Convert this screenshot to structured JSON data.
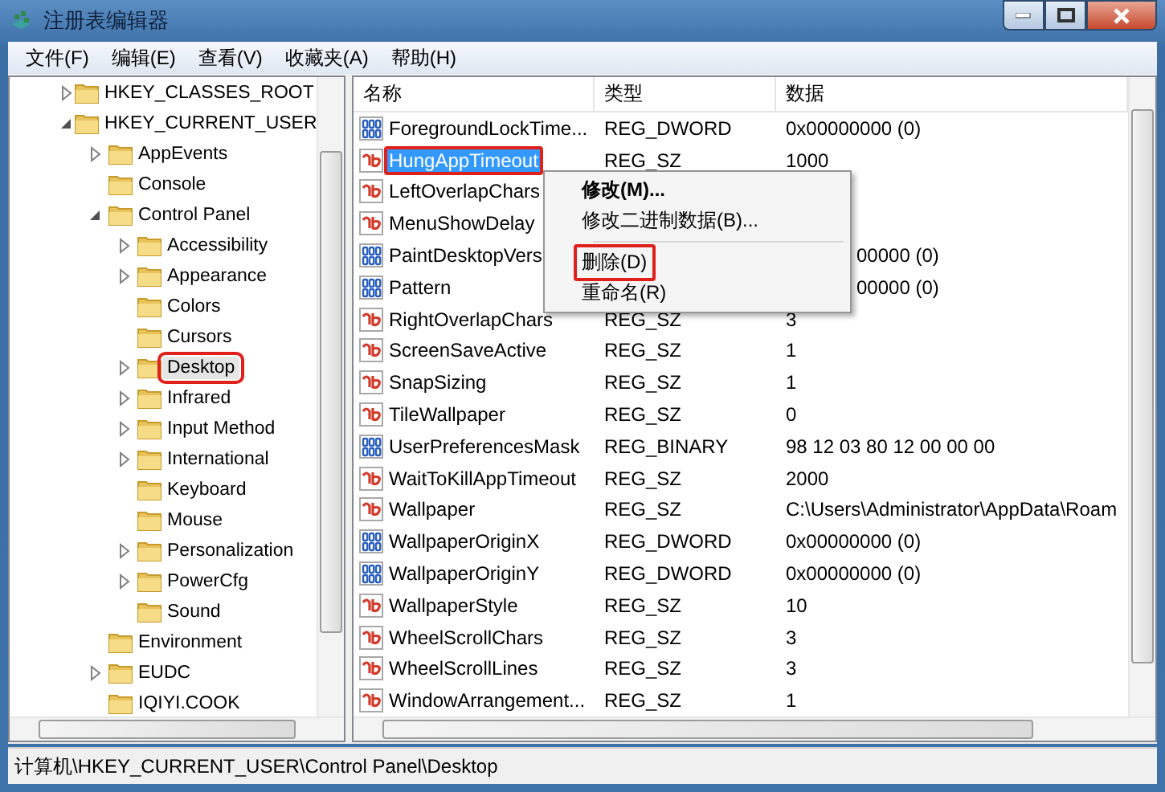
{
  "window": {
    "title": "注册表编辑器"
  },
  "menu_bar": [
    "文件(F)",
    "编辑(E)",
    "查看(V)",
    "收藏夹(A)",
    "帮助(H)"
  ],
  "tree": [
    {
      "label": "HKEY_CLASSES_ROOT",
      "expandable": true,
      "expanded": false,
      "selected": false,
      "annotated": false
    },
    {
      "label": "HKEY_CURRENT_USER",
      "expandable": true,
      "expanded": true,
      "selected": false,
      "annotated": false,
      "children": [
        {
          "label": "AppEvents",
          "expandable": true,
          "expanded": false,
          "selected": false,
          "annotated": false
        },
        {
          "label": "Console",
          "expandable": false,
          "selected": false,
          "annotated": false
        },
        {
          "label": "Control Panel",
          "expandable": true,
          "expanded": true,
          "selected": false,
          "annotated": false,
          "children": [
            {
              "label": "Accessibility",
              "expandable": true,
              "expanded": false,
              "selected": false,
              "annotated": false
            },
            {
              "label": "Appearance",
              "expandable": true,
              "expanded": false,
              "selected": false,
              "annotated": false
            },
            {
              "label": "Colors",
              "expandable": false,
              "selected": false,
              "annotated": false
            },
            {
              "label": "Cursors",
              "expandable": false,
              "selected": false,
              "annotated": false
            },
            {
              "label": "Desktop",
              "expandable": true,
              "expanded": false,
              "selected": true,
              "annotated": true
            },
            {
              "label": "Infrared",
              "expandable": true,
              "expanded": false,
              "selected": false,
              "annotated": false
            },
            {
              "label": "Input Method",
              "expandable": true,
              "expanded": false,
              "selected": false,
              "annotated": false
            },
            {
              "label": "International",
              "expandable": true,
              "expanded": false,
              "selected": false,
              "annotated": false
            },
            {
              "label": "Keyboard",
              "expandable": false,
              "selected": false,
              "annotated": false
            },
            {
              "label": "Mouse",
              "expandable": false,
              "selected": false,
              "annotated": false
            },
            {
              "label": "Personalization",
              "expandable": true,
              "expanded": false,
              "selected": false,
              "annotated": false
            },
            {
              "label": "PowerCfg",
              "expandable": true,
              "expanded": false,
              "selected": false,
              "annotated": false
            },
            {
              "label": "Sound",
              "expandable": false,
              "selected": false,
              "annotated": false
            }
          ]
        },
        {
          "label": "Environment",
          "expandable": false,
          "selected": false,
          "annotated": false
        },
        {
          "label": "EUDC",
          "expandable": true,
          "expanded": false,
          "selected": false,
          "annotated": false
        },
        {
          "label": "IQIYI.COOK",
          "expandable": false,
          "selected": false,
          "annotated": false
        }
      ]
    }
  ],
  "table": {
    "columns": [
      "名称",
      "类型",
      "数据"
    ],
    "rows": [
      {
        "kind": "binary",
        "name": "ForegroundLockTime...",
        "type": "REG_DWORD",
        "data": "0x00000000 (0)",
        "selected": false,
        "annotated": false
      },
      {
        "kind": "string",
        "name": "HungAppTimeout",
        "type": "REG_SZ",
        "data": "1000",
        "selected": true,
        "annotated": true
      },
      {
        "kind": "string",
        "name": "LeftOverlapChars",
        "selected": false,
        "annotated": false
      },
      {
        "kind": "string",
        "name": "MenuShowDelay",
        "selected": false,
        "annotated": false
      },
      {
        "kind": "binary",
        "name": "PaintDesktopVers",
        "data": "00000 (0)",
        "data_clipped": true,
        "selected": false,
        "annotated": false
      },
      {
        "kind": "binary",
        "name": "Pattern",
        "data": "00000 (0)",
        "data_clipped": true,
        "selected": false,
        "annotated": false
      },
      {
        "kind": "string",
        "name": "RightOverlapChars",
        "type": "REG_SZ",
        "data": "3",
        "selected": false,
        "annotated": false
      },
      {
        "kind": "string",
        "name": "ScreenSaveActive",
        "type": "REG_SZ",
        "data": "1",
        "selected": false,
        "annotated": false
      },
      {
        "kind": "string",
        "name": "SnapSizing",
        "type": "REG_SZ",
        "data": "1",
        "selected": false,
        "annotated": false
      },
      {
        "kind": "string",
        "name": "TileWallpaper",
        "type": "REG_SZ",
        "data": "0",
        "selected": false,
        "annotated": false
      },
      {
        "kind": "binary",
        "name": "UserPreferencesMask",
        "type": "REG_BINARY",
        "data": "98 12 03 80 12 00 00 00",
        "selected": false,
        "annotated": false
      },
      {
        "kind": "string",
        "name": "WaitToKillAppTimeout",
        "type": "REG_SZ",
        "data": "2000",
        "selected": false,
        "annotated": false
      },
      {
        "kind": "string",
        "name": "Wallpaper",
        "type": "REG_SZ",
        "data": "C:\\Users\\Administrator\\AppData\\Roam",
        "selected": false,
        "annotated": false
      },
      {
        "kind": "binary",
        "name": "WallpaperOriginX",
        "type": "REG_DWORD",
        "data": "0x00000000 (0)",
        "selected": false,
        "annotated": false
      },
      {
        "kind": "binary",
        "name": "WallpaperOriginY",
        "type": "REG_DWORD",
        "data": "0x00000000 (0)",
        "selected": false,
        "annotated": false
      },
      {
        "kind": "string",
        "name": "WallpaperStyle",
        "type": "REG_SZ",
        "data": "10",
        "selected": false,
        "annotated": false
      },
      {
        "kind": "string",
        "name": "WheelScrollChars",
        "type": "REG_SZ",
        "data": "3",
        "selected": false,
        "annotated": false
      },
      {
        "kind": "string",
        "name": "WheelScrollLines",
        "type": "REG_SZ",
        "data": "3",
        "selected": false,
        "annotated": false
      },
      {
        "kind": "string",
        "name": "WindowArrangement...",
        "type": "REG_SZ",
        "data": "1",
        "selected": false,
        "annotated": false
      }
    ]
  },
  "context_menu": [
    {
      "kind": "item",
      "label": "修改(M)...",
      "default": true,
      "annotated": false
    },
    {
      "kind": "item",
      "label": "修改二进制数据(B)...",
      "default": false,
      "annotated": false
    },
    {
      "kind": "separator"
    },
    {
      "kind": "item",
      "label": "删除(D)",
      "default": false,
      "annotated": true
    },
    {
      "kind": "item",
      "label": "重命名(R)",
      "default": false,
      "annotated": false
    }
  ],
  "status_bar": "计算机\\HKEY_CURRENT_USER\\Control Panel\\Desktop"
}
